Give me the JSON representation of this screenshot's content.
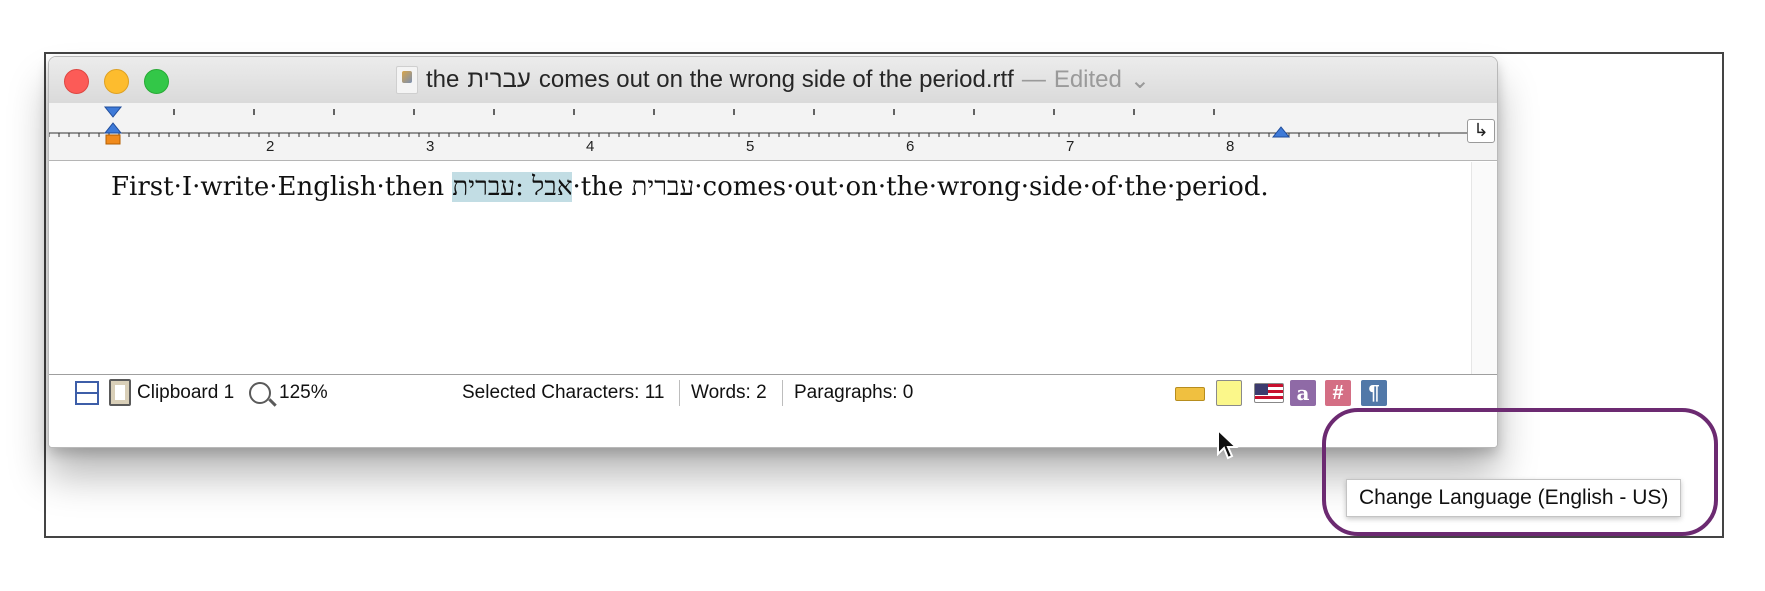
{
  "window": {
    "title_prefix": "the",
    "title_hebrew": "עברית",
    "title_suffix": "comes out on the wrong side of the period.rtf",
    "title_dash": "—",
    "title_status": "Edited"
  },
  "ruler": {
    "numbers": [
      "2",
      "3",
      "4",
      "5",
      "6",
      "7",
      "8"
    ],
    "return_symbol": "↳"
  },
  "document": {
    "text_before": "First·I·write·English·then ",
    "text_selected": "אבל :עברית",
    "text_after": "·the עברית·comes·out·on·the·wrong·side·of·the·period."
  },
  "statusbar": {
    "clipboard": "Clipboard 1",
    "zoom": "125%",
    "selected_characters": "Selected Characters: 11",
    "words": "Words: 2",
    "paragraphs": "Paragraphs: 0",
    "icons": [
      "ruler-icon",
      "text-color-icon",
      "language-flag-icon",
      "font-a-icon",
      "grid-hash-icon",
      "pilcrow-icon"
    ],
    "colors": {
      "ruler": "#f0c040",
      "color_swatch": "#fbf78a",
      "a_icon": "#8f6aa6",
      "hash_icon": "#d46e84",
      "pilcrow_icon": "#5178a8"
    }
  },
  "tooltip": {
    "text": "Change Language (English - US)"
  },
  "annotation": {
    "ring_color": "#6c2a71"
  }
}
